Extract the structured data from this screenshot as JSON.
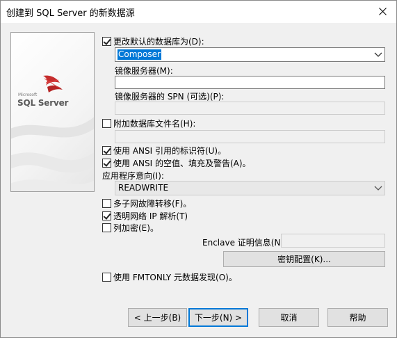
{
  "window": {
    "title": "创建到 SQL Server 的新数据源"
  },
  "logo": {
    "microsoft": "Microsoft",
    "brand": "SQL Server"
  },
  "options": {
    "change_default_db": {
      "label": "更改默认的数据库为(D):",
      "checked": true
    },
    "default_db_value": "Composer",
    "mirror_server_label": "镜像服务器(M):",
    "mirror_server_value": "",
    "mirror_spn_label": "镜像服务器的 SPN (可选)(P):",
    "mirror_spn_value": "",
    "attach_db_file": {
      "label": "附加数据库文件名(H):",
      "checked": false
    },
    "attach_db_value": "",
    "ansi_quoted": {
      "label": "使用 ANSI 引用的标识符(U)。",
      "checked": true
    },
    "ansi_nulls": {
      "label": "使用 ANSI 的空值、填充及警告(A)。",
      "checked": true
    },
    "app_intent_label": "应用程序意向(I):",
    "app_intent_value": "READWRITE",
    "multi_subnet": {
      "label": "多子网故障转移(F)。",
      "checked": false
    },
    "transparent_ip": {
      "label": "透明网络 IP 解析(T)",
      "checked": true
    },
    "encrypt": {
      "label": "列加密(E)。",
      "checked": false
    },
    "enclave_label": "Enclave 证明信息(N):",
    "enclave_value": "",
    "key_config_button": "密钥配置(K)...",
    "fmtonly": {
      "label": "使用 FMTONLY 元数据发现(O)。",
      "checked": false
    }
  },
  "buttons": {
    "back": "< 上一步(B)",
    "next": "下一步(N) >",
    "cancel": "取消",
    "help": "帮助"
  },
  "colors": {
    "accent": "#0078d7",
    "dialog_bg": "#f0f0f0"
  }
}
